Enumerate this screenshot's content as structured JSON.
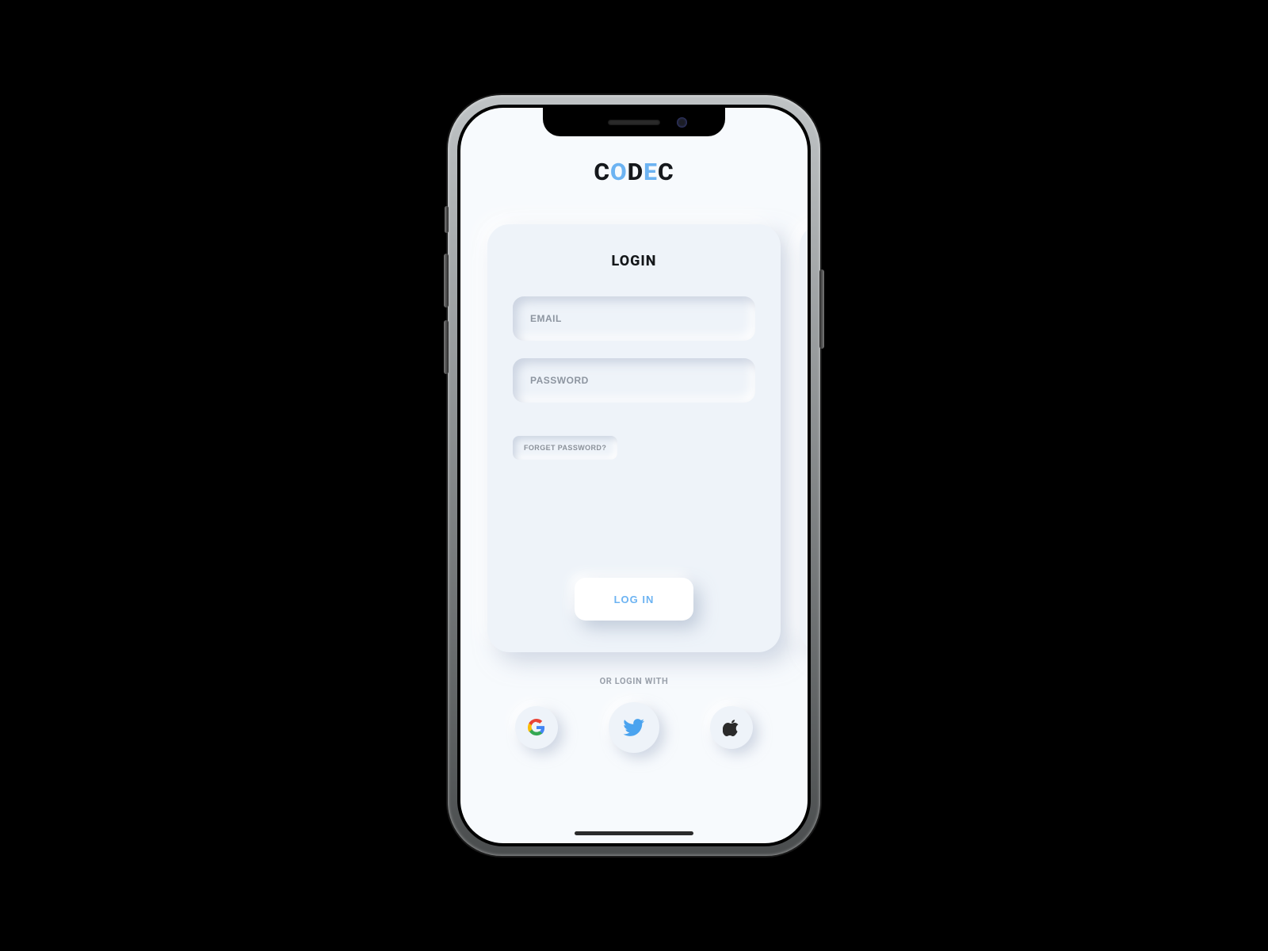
{
  "brand": {
    "c1": "C",
    "c2": "O",
    "c3": "D",
    "c4": "E",
    "c5": "C"
  },
  "card": {
    "title": "LOGIN",
    "email_ph": "EMAIL",
    "password_ph": "PASSWORD",
    "forget_label": "FORGET PASSWORD?",
    "login_label": "LOG IN"
  },
  "social": {
    "or_label": "OR LOGIN WITH",
    "google": "google-icon",
    "twitter": "twitter-icon",
    "apple": "apple-icon"
  },
  "colors": {
    "accent": "#6cb3f2",
    "bg": "#f7fafd",
    "card": "#eef3f9",
    "text_muted": "#8d95a0"
  }
}
